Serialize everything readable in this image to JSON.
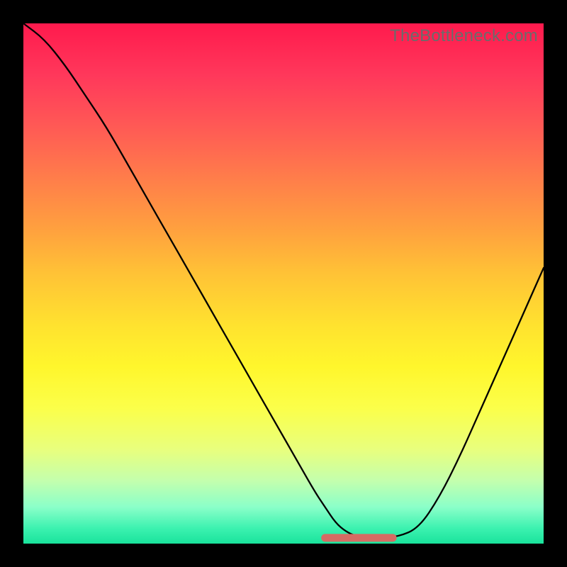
{
  "watermark": "TheBottleneck.com",
  "colors": {
    "frame": "#000000",
    "watermark": "#6b6b6b",
    "curve": "#000000",
    "marker": "#d66b63",
    "gradient_top": "#ff1a4d",
    "gradient_bottom": "#19e39c"
  },
  "chart_data": {
    "type": "line",
    "title": "",
    "xlabel": "",
    "ylabel": "",
    "xlim": [
      0,
      100
    ],
    "ylim": [
      0,
      100
    ],
    "grid": false,
    "legend": false,
    "x": [
      0,
      4,
      8,
      12,
      16,
      20,
      24,
      28,
      32,
      36,
      40,
      44,
      48,
      52,
      56,
      58,
      60,
      62,
      64,
      66,
      68,
      72,
      76,
      80,
      84,
      88,
      92,
      96,
      100
    ],
    "values": [
      100,
      97,
      92,
      86,
      80,
      73,
      66,
      59,
      52,
      45,
      38,
      31,
      24,
      17,
      10,
      7,
      4,
      2.3,
      1.4,
      1.1,
      1.1,
      1.3,
      3,
      9,
      17,
      26,
      35,
      44,
      53
    ],
    "annotations": [
      {
        "kind": "highlight-segment",
        "x_start": 58,
        "x_end": 71,
        "y": 1.1
      }
    ]
  }
}
